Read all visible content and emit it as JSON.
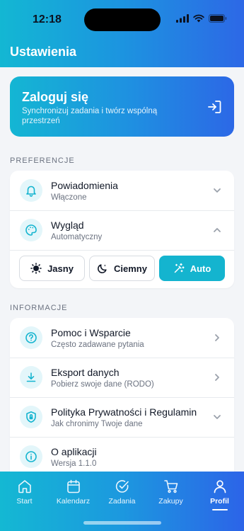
{
  "status_bar": {
    "time": "12:18"
  },
  "header": {
    "title": "Ustawienia"
  },
  "login": {
    "title": "Zaloguj się",
    "description": "Synchronizuj zadania i twórz wspólną przestrzeń"
  },
  "preferences": {
    "label": "PREFERENCJE",
    "notifications": {
      "title": "Powiadomienia",
      "subtitle": "Włączone"
    },
    "appearance": {
      "title": "Wygląd",
      "subtitle": "Automatyczny"
    },
    "theme_options": [
      {
        "label": "Jasny",
        "icon": "sun-icon",
        "selected": false
      },
      {
        "label": "Ciemny",
        "icon": "moon-icon",
        "selected": false
      },
      {
        "label": "Auto",
        "icon": "auto-theme-icon",
        "selected": true
      }
    ]
  },
  "info": {
    "label": "INFORMACJE",
    "items": [
      {
        "title": "Pomoc i Wsparcie",
        "subtitle": "Często zadawane pytania",
        "icon": "help-icon",
        "chevron": "right"
      },
      {
        "title": "Eksport danych",
        "subtitle": "Pobierz swoje dane (RODO)",
        "icon": "download-icon",
        "chevron": "right"
      },
      {
        "title": "Polityka Prywatności i Regulamin",
        "subtitle": "Jak chronimy Twoje dane",
        "icon": "shield-lock-icon",
        "chevron": "down"
      },
      {
        "title": "O aplikacji",
        "subtitle": "Wersja 1.1.0",
        "icon": "info-icon",
        "chevron": "none"
      }
    ]
  },
  "tabbar": {
    "tabs": [
      {
        "label": "Start",
        "icon": "home-icon",
        "active": false
      },
      {
        "label": "Kalendarz",
        "icon": "calendar-icon",
        "active": false
      },
      {
        "label": "Zadania",
        "icon": "check-circle-icon",
        "active": false
      },
      {
        "label": "Zakupy",
        "icon": "cart-icon",
        "active": false
      },
      {
        "label": "Profil",
        "icon": "person-icon",
        "active": true
      }
    ]
  },
  "colors": {
    "accent": "#14b4cf",
    "brand_gradient_end": "#2c68e6",
    "background": "#f3f5f8"
  }
}
